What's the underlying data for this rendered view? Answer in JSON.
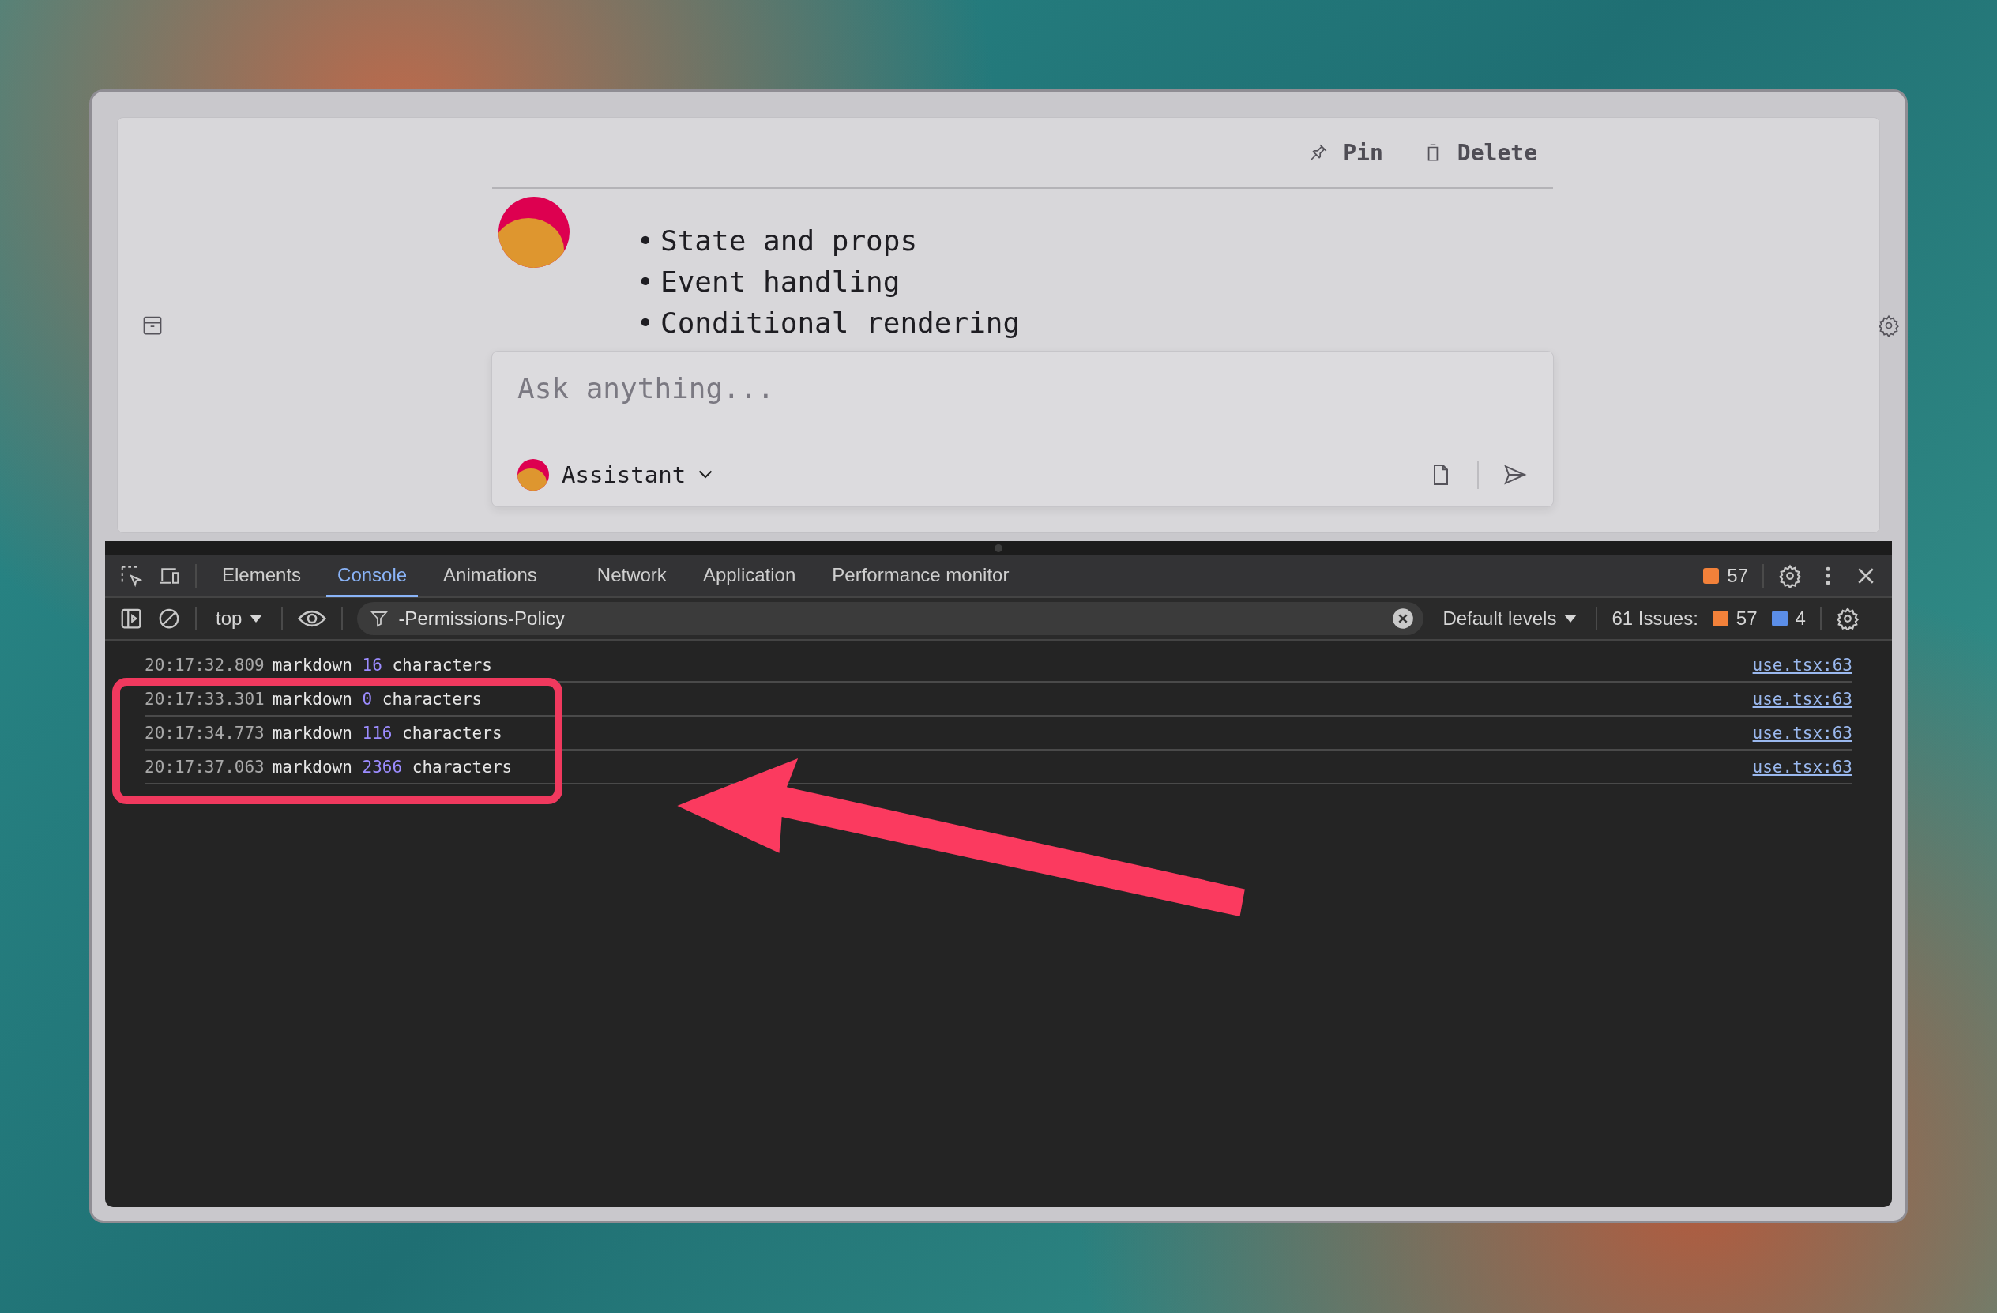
{
  "app": {
    "actions": [
      {
        "kind": "pin",
        "label": "Pin"
      },
      {
        "kind": "trash",
        "label": "Delete"
      }
    ],
    "message": {
      "marker": "•",
      "bullets": [
        "State and props",
        "Event handling",
        "Conditional rendering"
      ]
    },
    "composer": {
      "placeholder": "Ask anything...",
      "assistant": "Assistant"
    }
  },
  "devtools": {
    "tabs": [
      {
        "label": "Elements",
        "selected": false
      },
      {
        "label": "Console",
        "selected": true
      },
      {
        "label": "Animations",
        "selected": false
      },
      {
        "label": "Network",
        "selected": false
      },
      {
        "label": "Application",
        "selected": false
      },
      {
        "label": "Performance monitor",
        "selected": false
      }
    ],
    "warning_count": "57",
    "context": "top",
    "filter": "-Permissions-Policy",
    "levels": "Default levels",
    "issues": {
      "label": "61 Issues:",
      "warnings": "57",
      "info": "4"
    },
    "console": [
      {
        "time": "20:17:32.809",
        "word": "markdown",
        "count": "16",
        "unit": "characters",
        "source": "use.tsx:63"
      },
      {
        "time": "20:17:33.301",
        "word": "markdown",
        "count": "0",
        "unit": "characters",
        "source": "use.tsx:63"
      },
      {
        "time": "20:17:34.773",
        "word": "markdown",
        "count": "116",
        "unit": "characters",
        "source": "use.tsx:63"
      },
      {
        "time": "20:17:37.063",
        "word": "markdown",
        "count": "2366",
        "unit": "characters",
        "source": "use.tsx:63"
      }
    ]
  }
}
